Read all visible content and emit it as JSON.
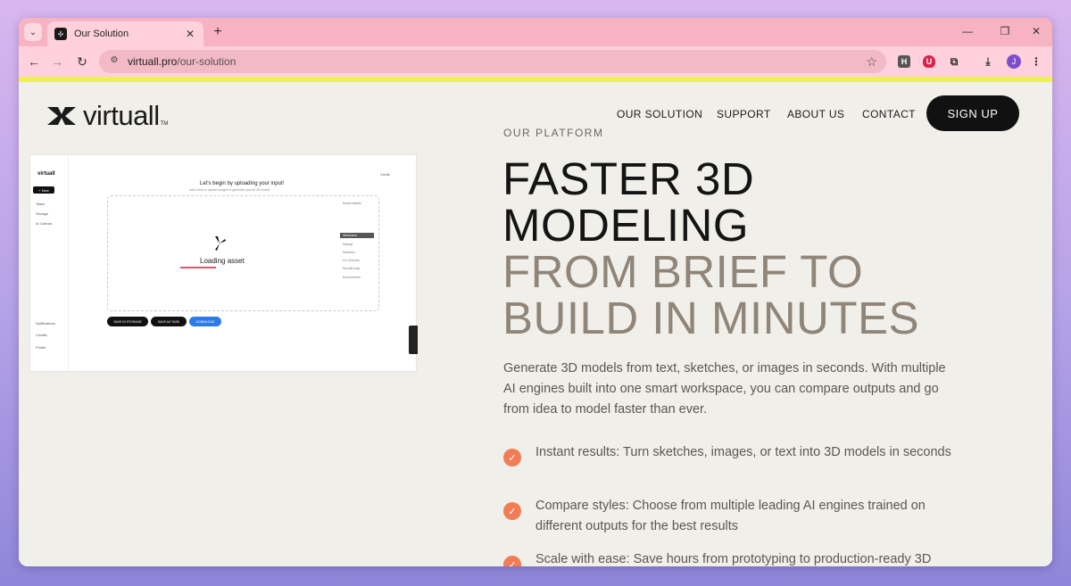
{
  "browser": {
    "tab": {
      "title": "Our Solution"
    },
    "address": {
      "host": "virtuall.pro",
      "path": "/our-solution"
    },
    "extensions": [
      "H",
      "U"
    ],
    "profile_initial": "J"
  },
  "header": {
    "logo_text": "virtuall",
    "logo_tm": "TM",
    "nav": [
      {
        "label": "OUR SOLUTION"
      },
      {
        "label": "SUPPORT"
      },
      {
        "label": "ABOUT US"
      },
      {
        "label": "CONTACT"
      }
    ],
    "signup_label": "SIGN UP"
  },
  "hero": {
    "eyebrow": "OUR PLATFORM",
    "headline_dark": [
      "FASTER 3D",
      "MODELING"
    ],
    "headline_muted": [
      "FROM BRIEF TO",
      "BUILD IN MINUTES"
    ],
    "lead": "Generate 3D models from text, sketches, or images in seconds. With multiple AI engines built into one smart workspace, you can compare outputs and go from idea to model faster than ever.",
    "features": [
      {
        "text": "Instant results: Turn sketches, images, or text into 3D models in seconds"
      },
      {
        "text": "Compare styles: Choose from multiple leading AI engines trained on different outputs for the best results"
      },
      {
        "text": "Scale with ease: Save hours from prototyping to production-ready 3D"
      }
    ]
  },
  "preview": {
    "brand": "virtuall",
    "new_label": "+ New",
    "side_items": [
      "Tasks",
      "Storage",
      "AI Canvas"
    ],
    "side_bottom": [
      "Notifications",
      "Credits",
      "Profile"
    ],
    "title": "Let's begin by uploading your input!",
    "subtitle": "Add a text or upload images to generate your AI 3D model",
    "credit": "Credit",
    "loading": "Loading asset",
    "panel_items": [
      "Model details",
      "Wireframe",
      "Matcap",
      "Skeleton",
      "UV Checker",
      "Normal map",
      "Environment"
    ],
    "buttons": [
      "SAVE IN STORAGE",
      "SAVE AS TASK",
      "DOWNLOAD"
    ]
  }
}
